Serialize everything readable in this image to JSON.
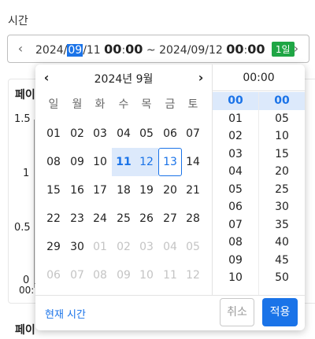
{
  "field": {
    "label": "시간"
  },
  "range": {
    "year_start": "2024/",
    "month_start": "09",
    "day_start": "/11",
    "time_start_h": "00",
    "colon": ":",
    "time_start_m": "00",
    "tilde": "~",
    "date_end": "2024/09/12",
    "time_end_h": "00",
    "time_end_m": "00",
    "span_badge": "1일",
    "prev_icon": "chevron-left-icon",
    "next_icon": "chevron-right-icon"
  },
  "background": {
    "card_title": "페이",
    "card2_title": "페이",
    "y_ticks": [
      "1.5",
      "1",
      "0.5",
      "0"
    ],
    "x_tick": "00:"
  },
  "calendar": {
    "month_label": "2024년 9월",
    "weekdays": [
      "일",
      "월",
      "화",
      "수",
      "목",
      "금",
      "토"
    ],
    "weeks": [
      [
        "01",
        "02",
        "03",
        "04",
        "05",
        "06",
        "07"
      ],
      [
        "08",
        "09",
        "10",
        "11",
        "12",
        "13",
        "14"
      ],
      [
        "15",
        "16",
        "17",
        "18",
        "19",
        "20",
        "21"
      ],
      [
        "22",
        "23",
        "24",
        "25",
        "26",
        "27",
        "28"
      ],
      [
        "29",
        "30",
        "01",
        "02",
        "03",
        "04",
        "05"
      ],
      [
        "06",
        "07",
        "08",
        "09",
        "10",
        "11",
        "12"
      ]
    ],
    "range_start": "11",
    "range_end": "13",
    "range_middle": "12"
  },
  "time": {
    "header": "00:00",
    "hours": [
      "00",
      "01",
      "02",
      "03",
      "04",
      "05",
      "06",
      "07",
      "08",
      "09",
      "10"
    ],
    "minutes": [
      "00",
      "05",
      "10",
      "15",
      "20",
      "25",
      "30",
      "35",
      "40",
      "45",
      "50"
    ],
    "selected_hour": "00",
    "selected_minute": "00"
  },
  "footer": {
    "now_label": "현재 시간",
    "cancel_label": "취소",
    "apply_label": "적용"
  },
  "colors": {
    "accent": "#1a73e8",
    "range_bg": "#dce9fb",
    "badge": "#1fa645"
  }
}
